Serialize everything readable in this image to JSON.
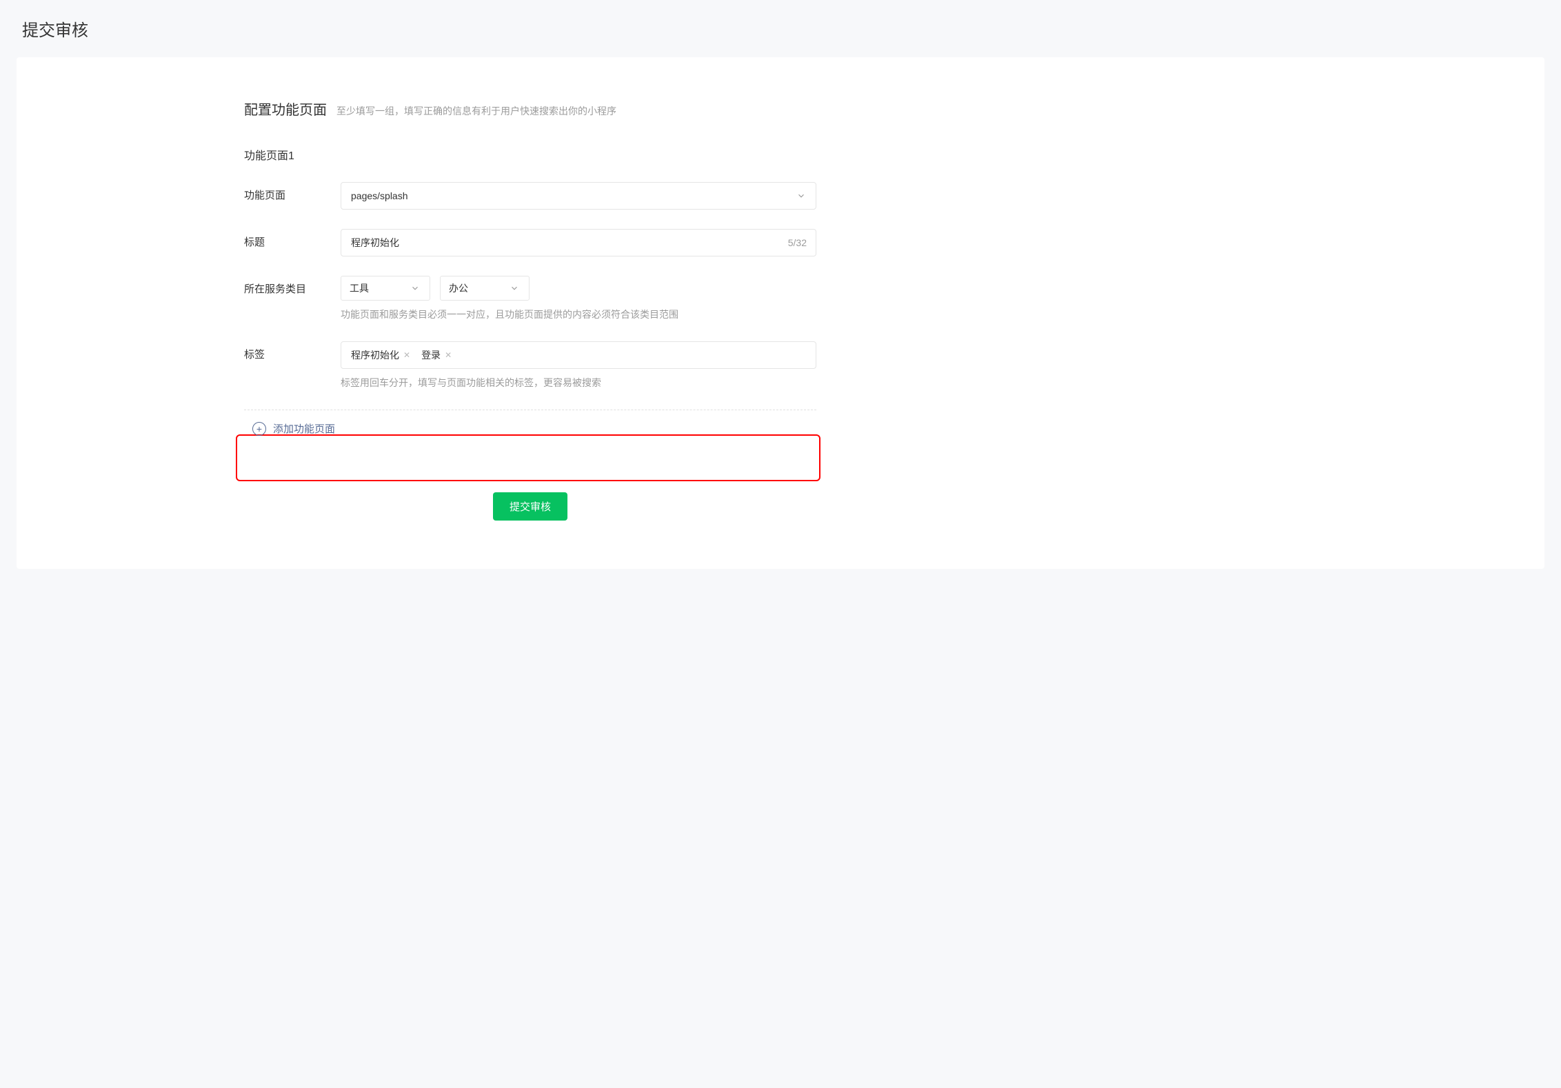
{
  "page_title": "提交审核",
  "section": {
    "title": "配置功能页面",
    "subtitle": "至少填写一组，填写正确的信息有利于用户快速搜索出你的小程序"
  },
  "group_title": "功能页面1",
  "fields": {
    "page": {
      "label": "功能页面",
      "value": "pages/splash"
    },
    "title": {
      "label": "标题",
      "value": "程序初始化",
      "count": "5/32"
    },
    "category": {
      "label": "所在服务类目",
      "primary": "工具",
      "secondary": "办公",
      "help": "功能页面和服务类目必须一一对应，且功能页面提供的内容必须符合该类目范围"
    },
    "tags": {
      "label": "标签",
      "items": [
        "程序初始化",
        "登录"
      ],
      "help": "标签用回车分开，填写与页面功能相关的标签，更容易被搜索"
    }
  },
  "add_page_label": "添加功能页面",
  "submit_label": "提交审核"
}
